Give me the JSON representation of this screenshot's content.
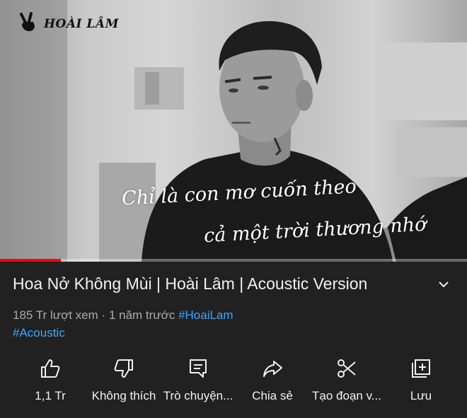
{
  "video": {
    "watermark": "HOÀI LÂM",
    "lyrics": [
      "Chỉ là con mơ cuốn theo",
      "cả một trời thương nhớ"
    ],
    "progress": 0.13
  },
  "info": {
    "title": "Hoa Nở Không Mùi | Hoài Lâm | Acoustic Version",
    "views": "185 Tr lượt xem",
    "separator": "·",
    "age": "1 năm trước",
    "hashtag1": "#HoaiLam",
    "hashtag2": "#Acoustic"
  },
  "actions": {
    "like": "1,1 Tr",
    "dislike": "Không thích",
    "chat": "Trò chuyện...",
    "share": "Chia sẻ",
    "clip": "Tạo đoạn v...",
    "save": "Lưu"
  },
  "icons": {
    "expand": "chevron-down-icon",
    "like": "thumbs-up-icon",
    "dislike": "thumbs-down-icon",
    "chat": "chat-icon",
    "share": "share-arrow-icon",
    "clip": "scissors-icon",
    "save": "add-to-playlist-icon"
  },
  "colors": {
    "background": "#212121",
    "text": "#f1f1f1",
    "secondary_text": "#aaaaaa",
    "hashtag": "#3ea6ff",
    "progress": "#ff0000"
  }
}
